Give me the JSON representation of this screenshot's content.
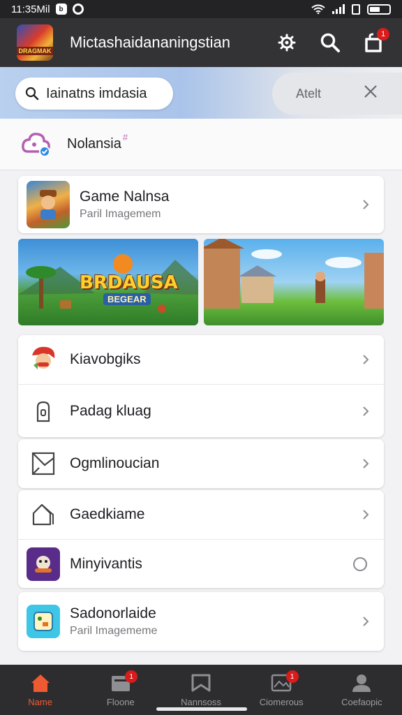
{
  "status_bar": {
    "time": "11:35Mil",
    "left_badge": "b"
  },
  "app_bar": {
    "title": "Mictashaidananingstian",
    "logo_text": "DRAGMAK",
    "notification_count": "1"
  },
  "search": {
    "placeholder": "Iainatns imdasia",
    "action_label": "Atelt"
  },
  "profile": {
    "name": "Nolansia",
    "mark": "#"
  },
  "featured_game": {
    "title": "Game Nalnsa",
    "subtitle": "Paril Imagemem"
  },
  "banners": {
    "left_title": "BRDAUSA",
    "left_subtitle": "BEGEAR"
  },
  "menu": [
    {
      "label": "Kiavobgiks"
    },
    {
      "label": "Padag kluag"
    },
    {
      "label": "Ogmlinoucian"
    },
    {
      "label": "Gaedkiame"
    },
    {
      "label": "Minyivantis"
    }
  ],
  "last_card": {
    "title": "Sadonorlaide",
    "subtitle": "Paril Imagememe"
  },
  "bottom_nav": [
    {
      "label": "Name",
      "badge": ""
    },
    {
      "label": "Floone",
      "badge": "1"
    },
    {
      "label": "Nannsoss",
      "badge": ""
    },
    {
      "label": "Ciomerous",
      "badge": "1"
    },
    {
      "label": "Coefaopic",
      "badge": ""
    }
  ],
  "colors": {
    "accent": "#ef5a32",
    "app_bar": "#333336",
    "badge": "#d81b1b"
  }
}
